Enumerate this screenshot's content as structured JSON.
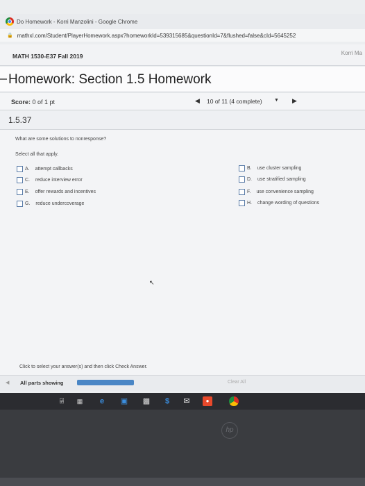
{
  "browser": {
    "window_title": "Do Homework - Korri Manzolini - Google Chrome",
    "url_main": "mathxl.com/Student/PlayerHomework.aspx?homeworkId=539315685&questionId=7&flushed=false&cId=5645252"
  },
  "course": {
    "title": "MATH 1530-E37 Fall 2019",
    "user_name": "Korri Ma"
  },
  "homework": {
    "title": "Homework: Section 1.5 Homework",
    "score_label": "Score:",
    "score_value": "0 of 1 pt",
    "question_status": "10 of 11 (4 complete)",
    "question_number": "1.5.37"
  },
  "question": {
    "text": "What are some solutions to nonresponse?",
    "instruction": "Select all that apply.",
    "options": [
      {
        "letter": "A.",
        "label": "attempt callbacks"
      },
      {
        "letter": "B.",
        "label": "use cluster sampling"
      },
      {
        "letter": "C.",
        "label": "reduce interview error"
      },
      {
        "letter": "D.",
        "label": "use stratified sampling"
      },
      {
        "letter": "E.",
        "label": "offer rewards and incentives"
      },
      {
        "letter": "F.",
        "label": "use convenience sampling"
      },
      {
        "letter": "G.",
        "label": "reduce undercoverage"
      },
      {
        "letter": "H.",
        "label": "change wording of questions"
      }
    ]
  },
  "footer": {
    "instructions": "Click to select your answer(s) and then click Check Answer.",
    "parts_label": "All parts showing",
    "progress_fraction": 1.0,
    "clear_all": "Clear All"
  },
  "taskbar": {
    "icons": [
      "microphone-icon",
      "task-view-icon",
      "edge-icon",
      "store-icon",
      "briefcase-icon",
      "dollar-icon",
      "mail-icon",
      "media-icon",
      "chrome-icon"
    ]
  },
  "colors": {
    "progress": "#4a86c5",
    "checkbox_border": "#5a7ca8"
  }
}
